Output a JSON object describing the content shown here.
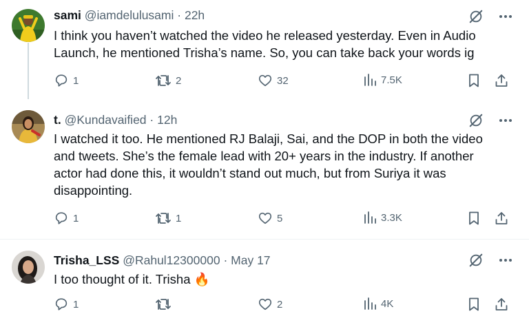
{
  "tweets": [
    {
      "display_name": "sami",
      "handle": "@iamdelulusami",
      "separator": "·",
      "time": "22h",
      "text": "I think you haven’t watched the video he released yesterday. Even in Audio\nLaunch, he mentioned Trisha’s name. So, you can take back your words ig",
      "replies": "1",
      "retweets": "2",
      "likes": "32",
      "views": "7.5K"
    },
    {
      "display_name": "t.",
      "handle": "@Kundavaified",
      "separator": "·",
      "time": "12h",
      "text": "I watched it too. He mentioned RJ Balaji, Sai, and the DOP in both the video\nand tweets. She’s the female lead with 20+ years in the industry. If another\nactor had done this, it wouldn’t stand out much, but from Suriya it was\ndisappointing.",
      "replies": "1",
      "retweets": "1",
      "likes": "5",
      "views": "3.3K"
    },
    {
      "display_name": "Trisha_LSS",
      "handle": "@Rahul12300000",
      "separator": "·",
      "time": "May 17",
      "text": "I too thought of it. Trisha 🔥",
      "replies": "1",
      "retweets": "",
      "likes": "2",
      "views": "4K"
    }
  ],
  "icons": {
    "grok": "grok-icon",
    "more": "more-icon",
    "reply": "reply-icon",
    "retweet": "retweet-icon",
    "like": "heart-icon",
    "views": "views-icon",
    "bookmark": "bookmark-icon",
    "share": "share-icon"
  },
  "colors": {
    "text": "#0f1419",
    "secondary": "#536471",
    "divider": "#eff3f4",
    "thread_line": "#cfd9de"
  }
}
